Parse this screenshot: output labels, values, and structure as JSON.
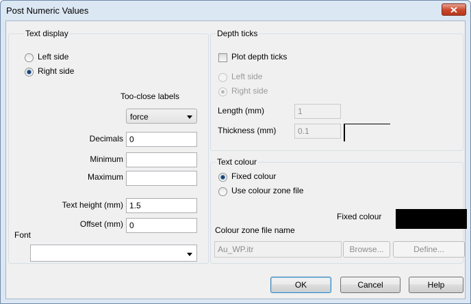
{
  "window": {
    "title": "Post Numeric Values"
  },
  "text_display": {
    "legend": "Text display",
    "left_side": "Left side",
    "right_side": "Right side",
    "selected": "right",
    "too_close_label": "Too-close labels",
    "too_close_value": "force",
    "decimals_label": "Decimals",
    "decimals_value": "0",
    "minimum_label": "Minimum",
    "minimum_value": "",
    "maximum_label": "Maximum",
    "maximum_value": "",
    "text_height_label": "Text height (mm)",
    "text_height_value": "1.5",
    "offset_label": "Offset (mm)",
    "offset_value": "0",
    "font_label": "Font",
    "font_value": ""
  },
  "depth_ticks": {
    "legend": "Depth ticks",
    "plot_label": "Plot depth ticks",
    "plot_checked": false,
    "left_side": "Left side",
    "right_side": "Right side",
    "length_label": "Length (mm)",
    "length_value": "1",
    "thickness_label": "Thickness (mm)",
    "thickness_value": "0.1"
  },
  "text_colour": {
    "legend": "Text colour",
    "fixed_label": "Fixed colour",
    "zone_label": "Use colour zone file",
    "selected": "fixed",
    "fixed_colour_label": "Fixed colour",
    "fixed_colour_value": "#000000",
    "zone_file_label": "Colour zone file name",
    "zone_file_value": "Au_WP.itr",
    "browse_label": "Browse...",
    "define_label": "Define..."
  },
  "buttons": {
    "ok": "OK",
    "cancel": "Cancel",
    "help": "Help"
  },
  "icons": {
    "close": "close-icon",
    "dropdown": "chevron-down-icon"
  },
  "colors": {
    "dialog_frame": "#dbe7f3",
    "client_bg": "#f0f0f0",
    "close_button": "#c9472b"
  }
}
